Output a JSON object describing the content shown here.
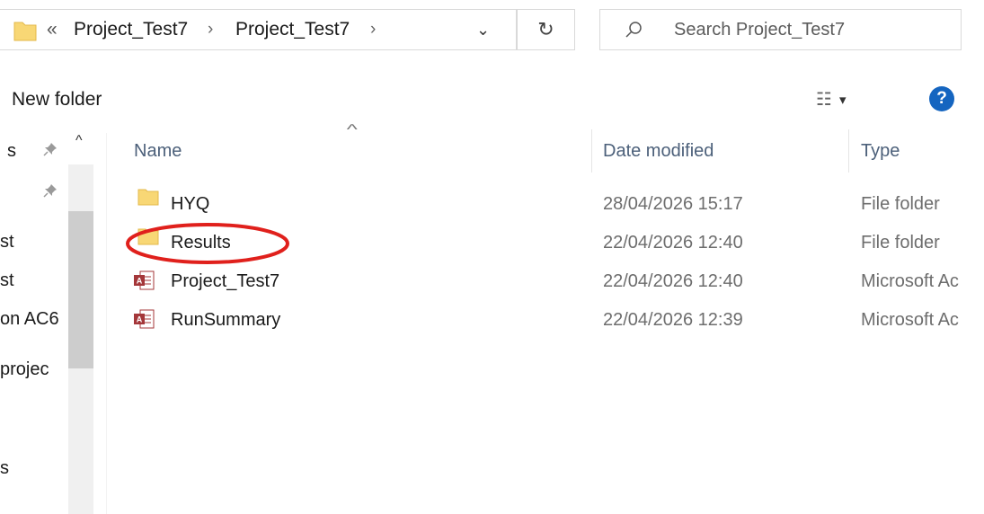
{
  "address_bar": {
    "overflow_chevron": "«",
    "crumbs": [
      "Project_Test7",
      "Project_Test7"
    ],
    "separator": "›",
    "dropdown": "⌄",
    "refresh_glyph": "↻"
  },
  "search": {
    "placeholder": "Search Project_Test7",
    "icon": "search-icon"
  },
  "toolbar": {
    "new_folder_label": "New folder",
    "view_glyph": "☷",
    "view_dropdown": "▾",
    "help_label": "?"
  },
  "nav_pane": {
    "items": [
      "s",
      "st",
      "st",
      "on AC6",
      "projec",
      "s"
    ],
    "pin_glyph": "📌",
    "up_glyph": "^"
  },
  "columns": {
    "name": "Name",
    "date_modified": "Date modified",
    "type": "Type",
    "sort_indicator": "^"
  },
  "files": [
    {
      "name": "HYQ",
      "date": "28/04/2026 15:17",
      "type": "File folder",
      "icon": "folder-icon"
    },
    {
      "name": "Results",
      "date": "22/04/2026 12:40",
      "type": "File folder",
      "icon": "folder-icon"
    },
    {
      "name": "Project_Test7",
      "date": "22/04/2026 12:40",
      "type": "Microsoft Ac",
      "icon": "access-file-icon"
    },
    {
      "name": "RunSummary",
      "date": "22/04/2026 12:39",
      "type": "Microsoft Ac",
      "icon": "access-file-icon"
    }
  ],
  "colors": {
    "folder": "#f8d775",
    "access": "#a4373a",
    "help": "#1565c0",
    "annotation": "#e0201c",
    "header_text": "#4c607a"
  }
}
